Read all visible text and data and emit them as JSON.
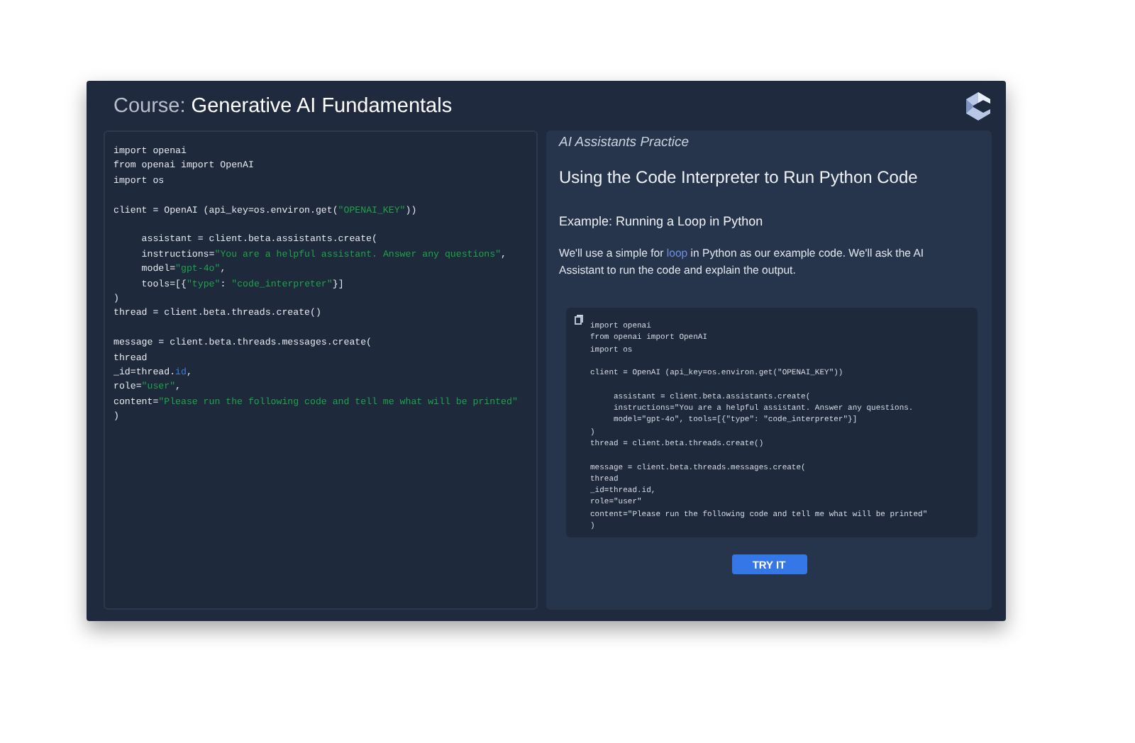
{
  "header": {
    "prefix": "Course:",
    "title": "Generative AI Fundamentals"
  },
  "editor": {
    "blocks": [
      [
        [
          {
            "kind": "plain",
            "text": "import openai"
          }
        ],
        [
          {
            "kind": "plain",
            "text": "from openai import OpenAI"
          }
        ],
        [
          {
            "kind": "plain",
            "text": "import os"
          }
        ]
      ],
      [
        [
          {
            "kind": "plain",
            "text": "client = OpenAI (api_key=os.environ.get("
          },
          {
            "kind": "string",
            "text": "\"OPENAI_KEY\""
          },
          {
            "kind": "plain",
            "text": "))"
          }
        ]
      ],
      [
        [
          {
            "kind": "plain",
            "text": "     assistant = client.beta.assistants.create("
          }
        ],
        [
          {
            "kind": "plain",
            "text": "     instructions="
          },
          {
            "kind": "string",
            "text": "\"You are a helpful assistant. Answer any questions\""
          },
          {
            "kind": "plain",
            "text": ","
          }
        ],
        [
          {
            "kind": "plain",
            "text": "     model="
          },
          {
            "kind": "string",
            "text": "\"gpt-4o\""
          },
          {
            "kind": "plain",
            "text": ","
          }
        ],
        [
          {
            "kind": "plain",
            "text": "     tools=[{"
          },
          {
            "kind": "string",
            "text": "\"type\""
          },
          {
            "kind": "plain",
            "text": ": "
          },
          {
            "kind": "string",
            "text": "\"code_interpreter\""
          },
          {
            "kind": "plain",
            "text": "}]"
          }
        ],
        [
          {
            "kind": "plain",
            "text": ")"
          }
        ],
        [
          {
            "kind": "plain",
            "text": "thread = client.beta.threads.create()"
          }
        ]
      ],
      [
        [
          {
            "kind": "plain",
            "text": "message = client.beta.threads.messages.create("
          }
        ],
        [
          {
            "kind": "plain",
            "text": "thread"
          }
        ],
        [
          {
            "kind": "plain",
            "text": "_id=thread."
          },
          {
            "kind": "attr",
            "text": "id"
          },
          {
            "kind": "plain",
            "text": ","
          }
        ],
        [
          {
            "kind": "plain",
            "text": "role="
          },
          {
            "kind": "string",
            "text": "\"user\""
          },
          {
            "kind": "plain",
            "text": ","
          }
        ],
        [
          {
            "kind": "plain",
            "text": "content="
          },
          {
            "kind": "string",
            "text": "\"Please run the following code and tell me what will be printed\""
          }
        ],
        [
          {
            "kind": "plain",
            "text": ")"
          }
        ]
      ]
    ]
  },
  "lesson": {
    "section": "AI Assistants Practice",
    "title": "Using the Code Interpreter to Run Python Code",
    "subtitle": "Example: Running a Loop in Python",
    "paragraph": [
      {
        "kind": "plain",
        "text": "We'll use a simple for "
      },
      {
        "kind": "link",
        "text": "loop"
      },
      {
        "kind": "plain",
        "text": " in Python as our example code. We'll ask the AI Assistant to run the code and explain the output."
      }
    ],
    "example_blocks": [
      [
        "import openai",
        "from openai import OpenAI",
        "import os"
      ],
      [
        "client = OpenAI (api_key=os.environ.get(\"OPENAI_KEY\"))"
      ],
      [
        "     assistant = client.beta.assistants.create(",
        "     instructions=\"You are a helpful assistant. Answer any questions.",
        "     model=\"gpt-4o\", tools=[{\"type\": \"code_interpreter\"}]",
        ")",
        "thread = client.beta.threads.create()"
      ],
      [
        "message = client.beta.threads.messages.create(",
        "thread",
        "_id=thread.id,",
        "role=\"user\"",
        "content=\"Please run the following code and tell me what will be printed\"",
        ")"
      ]
    ],
    "button": "TRY IT"
  }
}
